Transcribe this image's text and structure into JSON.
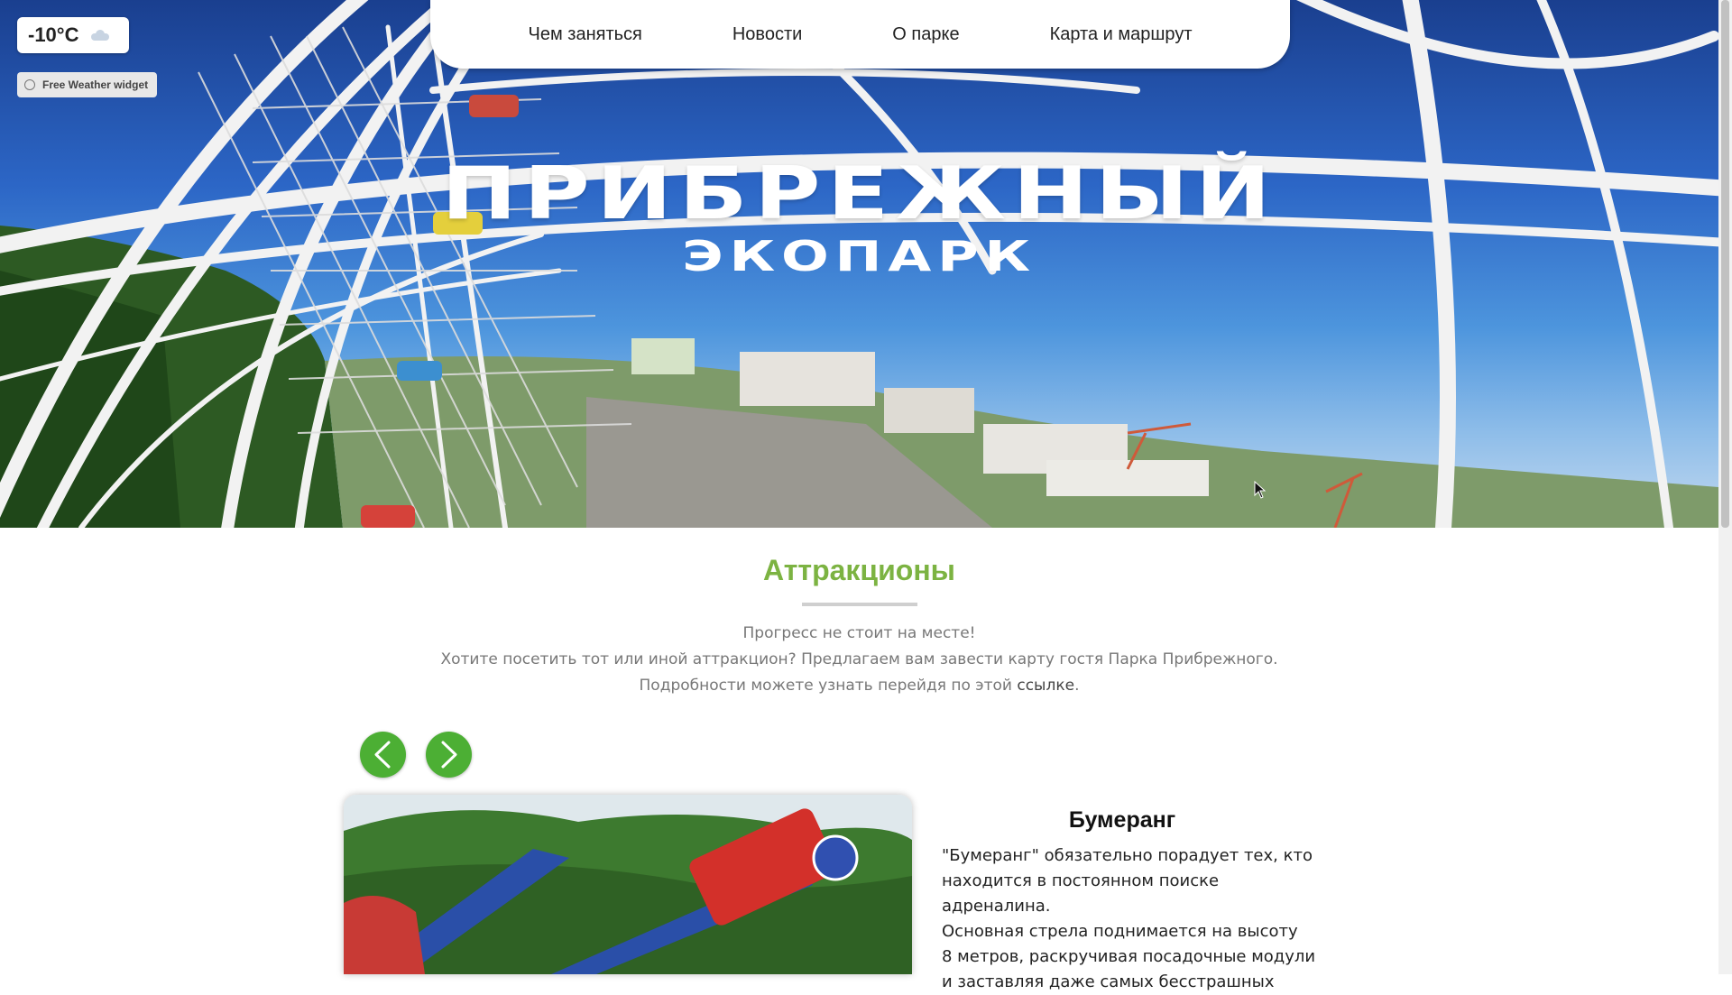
{
  "weather": {
    "temperature": "-10°C",
    "condition_icon": "cloud-icon",
    "widget_label": "Free Weather widget"
  },
  "nav": {
    "items": [
      {
        "label": "Чем заняться"
      },
      {
        "label": "Новости"
      },
      {
        "label": "О парке"
      },
      {
        "label": "Карта и маршрут"
      }
    ]
  },
  "hero": {
    "title": "Прибрежный",
    "subtitle": "Экопарк"
  },
  "section": {
    "title": "Аттракционы",
    "intro_line1": "Прогресс не стоит на месте!",
    "intro_line2": "Хотите посетить тот или иной аттракцион? Предлагаем вам завести карту гостя Парка Прибрежного.",
    "intro_line3_prefix": "Подробности можете узнать перейдя по этой",
    "intro_link": "ссылке",
    "intro_line3_suffix": "."
  },
  "carousel": {
    "prev_icon": "chevron-left-icon",
    "next_icon": "chevron-right-icon",
    "accent_color": "#4caf34"
  },
  "attraction": {
    "name": "Бумеранг",
    "description_lines": [
      "\"Бумеранг\" обязательно порадует тех, кто",
      "находится в постоянном поиске адреналина.",
      "Основная стрела поднимается на высоту",
      "8 метров, раскручивая посадочные модули",
      "и заставляя даже самых бесстрашных"
    ]
  },
  "colors": {
    "section_title": "#7cb342",
    "sky_top": "#1a3f8f"
  }
}
